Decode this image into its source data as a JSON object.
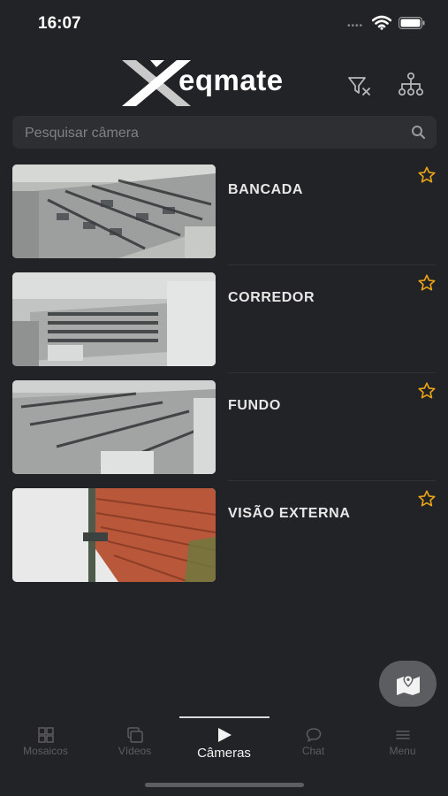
{
  "status_bar": {
    "time": "16:07",
    "signal": "••••"
  },
  "header": {
    "logo_text": "eqmate"
  },
  "search": {
    "placeholder": "Pesquisar câmera",
    "value": ""
  },
  "colors": {
    "accent_star": "#e8a418",
    "background": "#222326",
    "search_bg": "#2e2f33",
    "fab_bg": "#5b5d61"
  },
  "cameras": [
    {
      "name": "BANCADA",
      "favorite": false,
      "icon": "star-outline-icon"
    },
    {
      "name": "CORREDOR",
      "favorite": false,
      "icon": "star-outline-icon"
    },
    {
      "name": "FUNDO",
      "favorite": false,
      "icon": "star-outline-icon"
    },
    {
      "name": "VISÃO EXTERNA",
      "favorite": false,
      "icon": "star-outline-icon"
    }
  ],
  "tabs": [
    {
      "label": "Mosaicos",
      "icon": "grid-icon",
      "active": false
    },
    {
      "label": "Vídeos",
      "icon": "videos-icon",
      "active": false
    },
    {
      "label": "Câmeras",
      "icon": "play-icon",
      "active": true
    },
    {
      "label": "Chat",
      "icon": "chat-bubble-icon",
      "active": false
    },
    {
      "label": "Menu",
      "icon": "menu-icon",
      "active": false
    }
  ]
}
